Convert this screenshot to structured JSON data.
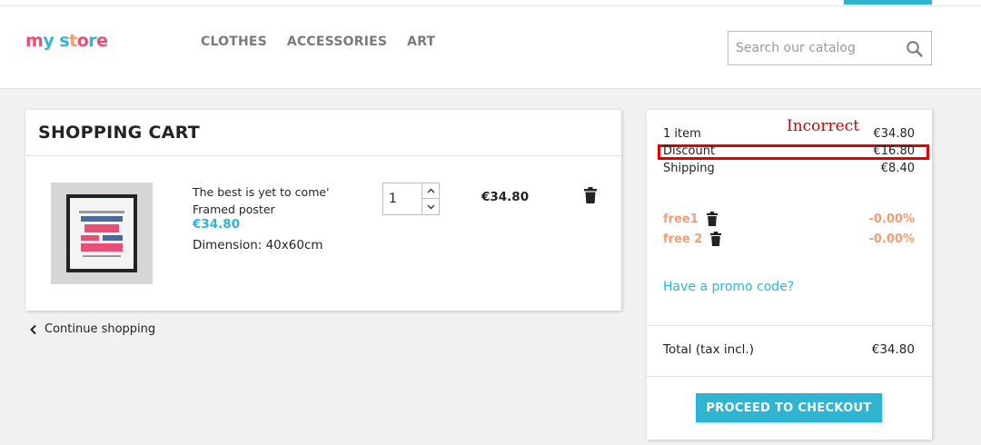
{
  "header": {
    "logo": {
      "letters": [
        "m",
        "y",
        " ",
        "s",
        "t",
        "o",
        "r",
        "e"
      ]
    },
    "nav": [
      "CLOTHES",
      "ACCESSORIES",
      "ART"
    ],
    "search": {
      "placeholder": "Search our catalog",
      "value": ""
    }
  },
  "cart": {
    "title": "SHOPPING CART",
    "item": {
      "name": "The best is yet to come' Framed poster",
      "price": "€34.80",
      "dimension": "Dimension: 40x60cm",
      "quantity": "1",
      "line_total": "€34.80"
    },
    "continue_label": "Continue shopping"
  },
  "summary": {
    "annotation": "Incorrect",
    "items": {
      "label": "1 item",
      "value": "€34.80"
    },
    "discount": {
      "label": "Discount",
      "value": "€16.80"
    },
    "shipping": {
      "label": "Shipping",
      "value": "€8.40"
    },
    "vouchers": [
      {
        "name": "free1",
        "value": "-0.00%"
      },
      {
        "name": "free 2",
        "value": "-0.00%"
      }
    ],
    "promo_link": "Have a promo code?",
    "total": {
      "label": "Total (tax incl.)",
      "value": "€34.80"
    },
    "checkout_label": "PROCEED TO CHECKOUT"
  },
  "colors": {
    "accent": "#2fb5d2",
    "voucher": "#f39d72",
    "annotation": "#e50000"
  }
}
